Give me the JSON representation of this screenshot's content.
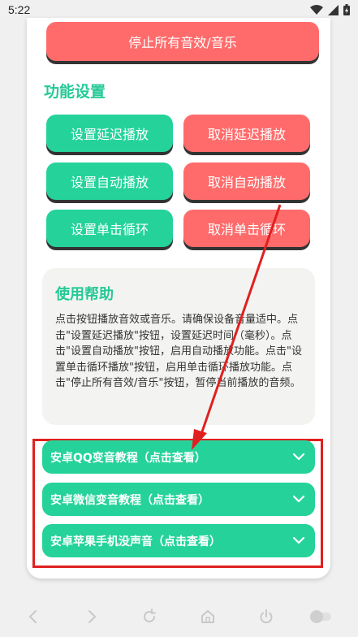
{
  "status": {
    "time": "5:22"
  },
  "stop_button": {
    "label": "停止所有音效/音乐"
  },
  "settings": {
    "title": "功能设置",
    "buttons": [
      {
        "label": "设置延迟播放"
      },
      {
        "label": "取消延迟播放"
      },
      {
        "label": "设置自动播放"
      },
      {
        "label": "取消自动播放"
      },
      {
        "label": "设置单击循环"
      },
      {
        "label": "取消单击循环"
      }
    ]
  },
  "help": {
    "title": "使用帮助",
    "text": "点击按钮播放音效或音乐。请确保设备音量适中。点击\"设置延迟播放\"按钮，设置延迟时间（毫秒）。点击\"设置自动播放\"按钮，启用自动播放功能。点击\"设置单击循环播放\"按钮，启用单击循环播放功能。点击\"停止所有音效/音乐\"按钮，暂停当前播放的音频。"
  },
  "tutorials": [
    {
      "label": "安卓QQ变音教程（点击查看）"
    },
    {
      "label": "安卓微信变音教程（点击查看）"
    },
    {
      "label": "安卓苹果手机没声音（点击查看）"
    }
  ],
  "colors": {
    "green": "#25d39a",
    "red": "#ff6b6b",
    "title_green": "#26c996",
    "highlight": "#e02020"
  },
  "icons": [
    "wifi-icon",
    "signal-icon",
    "battery-icon",
    "chevron-down-icon",
    "back-icon",
    "forward-icon",
    "refresh-icon",
    "home-icon",
    "power-icon",
    "toggle-icon"
  ]
}
